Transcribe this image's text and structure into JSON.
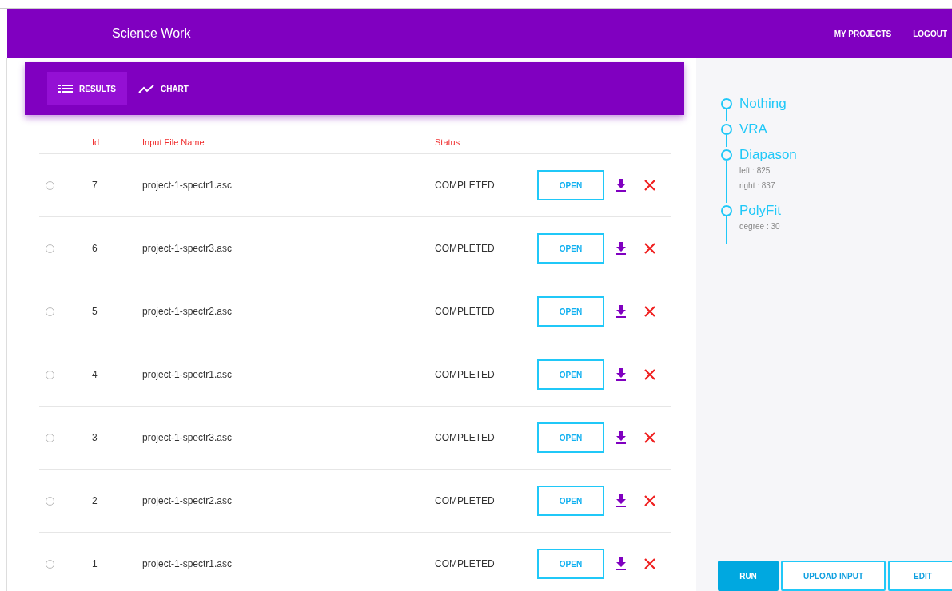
{
  "app_bar": {
    "title": "Science Work",
    "links": [
      "MY PROJECTS",
      "LOGOUT"
    ]
  },
  "tabs": [
    {
      "label": "RESULTS",
      "kind": "list",
      "selected": true
    },
    {
      "label": "CHART",
      "kind": "chart",
      "selected": false
    }
  ],
  "table": {
    "columns": [
      "Id",
      "Input File Name",
      "Status"
    ],
    "rows": [
      {
        "selected": false,
        "id": "7",
        "file": "project-1-spectr1.asc",
        "status": "COMPLETED",
        "action": "OPEN"
      },
      {
        "selected": false,
        "id": "6",
        "file": "project-1-spectr3.asc",
        "status": "COMPLETED",
        "action": "OPEN"
      },
      {
        "selected": false,
        "id": "5",
        "file": "project-1-spectr2.asc",
        "status": "COMPLETED",
        "action": "OPEN"
      },
      {
        "selected": false,
        "id": "4",
        "file": "project-1-spectr1.asc",
        "status": "COMPLETED",
        "action": "OPEN"
      },
      {
        "selected": false,
        "id": "3",
        "file": "project-1-spectr3.asc",
        "status": "COMPLETED",
        "action": "OPEN"
      },
      {
        "selected": false,
        "id": "2",
        "file": "project-1-spectr2.asc",
        "status": "COMPLETED",
        "action": "OPEN"
      },
      {
        "selected": false,
        "id": "1",
        "file": "project-1-spectr1.asc",
        "status": "COMPLETED",
        "action": "OPEN"
      }
    ]
  },
  "pipeline": [
    {
      "name": "Nothing"
    },
    {
      "name": "VRA"
    },
    {
      "name": "Diapason",
      "params": [
        "left : 825",
        "right : 837"
      ]
    },
    {
      "name": "PolyFit",
      "params": [
        "degree : 30"
      ]
    }
  ],
  "actions": [
    {
      "label": "RUN",
      "kind": "primary"
    },
    {
      "label": "UPLOAD INPUT",
      "kind": "outline"
    },
    {
      "label": "EDIT",
      "kind": "outline"
    }
  ]
}
